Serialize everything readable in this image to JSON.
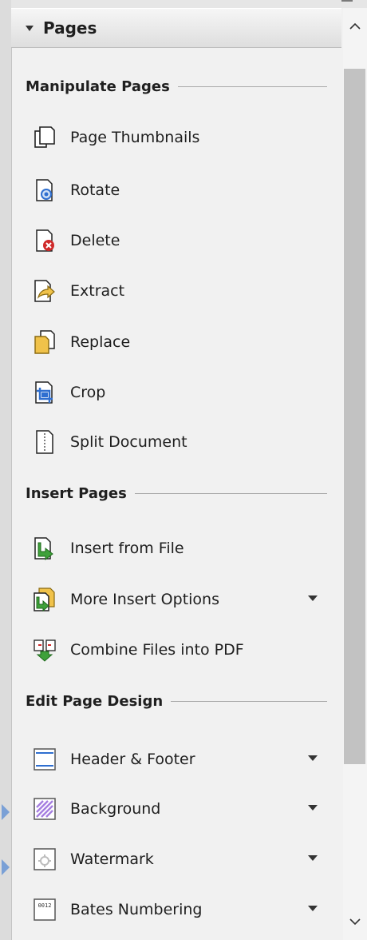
{
  "panel": {
    "title": "Pages"
  },
  "sections": {
    "manipulate": {
      "title": "Manipulate Pages",
      "items": [
        {
          "label": "Page Thumbnails"
        },
        {
          "label": "Rotate"
        },
        {
          "label": "Delete"
        },
        {
          "label": "Extract"
        },
        {
          "label": "Replace"
        },
        {
          "label": "Crop"
        },
        {
          "label": "Split Document"
        }
      ]
    },
    "insert": {
      "title": "Insert Pages",
      "items": [
        {
          "label": "Insert from File"
        },
        {
          "label": "More Insert Options"
        },
        {
          "label": "Combine Files into PDF"
        }
      ]
    },
    "design": {
      "title": "Edit Page Design",
      "items": [
        {
          "label": "Header & Footer"
        },
        {
          "label": "Background"
        },
        {
          "label": "Watermark"
        },
        {
          "label": "Bates Numbering",
          "icon_text": "0012"
        }
      ]
    }
  },
  "colors": {
    "accent_blue": "#2f6fd0",
    "delete_red": "#d02a2a",
    "folder_yellow": "#f0c24a",
    "insert_green": "#3fa13a",
    "background_purple": "#a57ee0",
    "scroll_thumb": "#c2c2c2"
  }
}
